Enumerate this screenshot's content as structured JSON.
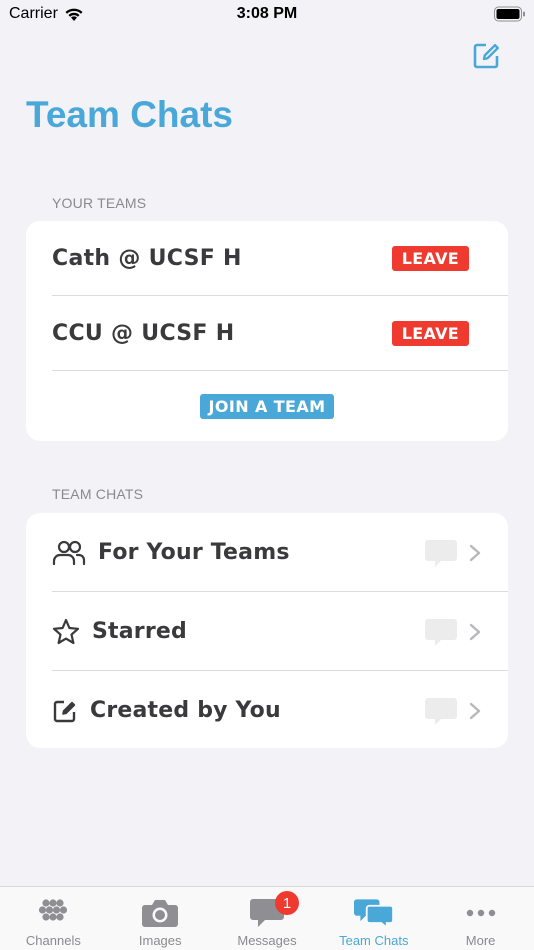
{
  "status_bar": {
    "carrier": "Carrier",
    "time": "3:08 PM"
  },
  "header": {
    "title": "Team Chats",
    "compose_icon": "compose-icon"
  },
  "your_teams": {
    "header": "YOUR TEAMS",
    "teams": [
      {
        "name": "Cath @ UCSF H",
        "action": "LEAVE"
      },
      {
        "name": "CCU @ UCSF H",
        "action": "LEAVE"
      }
    ],
    "join_label": "JOIN A TEAM"
  },
  "team_chats": {
    "header": "TEAM CHATS",
    "rows": [
      {
        "label": "For Your Teams",
        "icon": "people-icon"
      },
      {
        "label": "Starred",
        "icon": "star-icon"
      },
      {
        "label": "Created by You",
        "icon": "compose-icon"
      }
    ]
  },
  "tab_bar": {
    "tabs": [
      {
        "label": "Channels",
        "icon": "channels-icon"
      },
      {
        "label": "Images",
        "icon": "camera-icon"
      },
      {
        "label": "Messages",
        "icon": "message-icon",
        "badge": "1"
      },
      {
        "label": "Team Chats",
        "icon": "team-chats-icon",
        "active": true
      },
      {
        "label": "More",
        "icon": "more-icon"
      }
    ]
  },
  "colors": {
    "accent": "#4aa8d8",
    "danger": "#ef3b2f",
    "background": "#f2f2f7"
  }
}
